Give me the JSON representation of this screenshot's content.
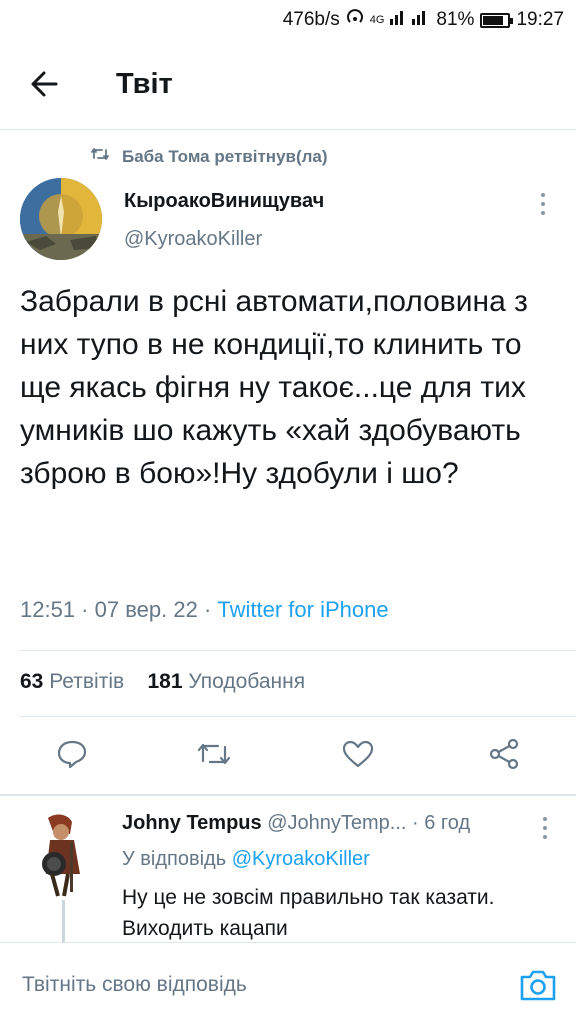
{
  "status_bar": {
    "speed": "476b/s",
    "network": "4G",
    "battery": "81%",
    "time": "19:27"
  },
  "header": {
    "title": "Твіт"
  },
  "retweet": {
    "text": "Баба Тома ретвітнув(ла)"
  },
  "tweet": {
    "author_name": "КыроакоВинищувач",
    "author_handle": "@KyroakoKiller",
    "text": "Забрали в рсні автомати,половина з них тупо в не кондиції,то клинить то ще якась фігня ну такоє...це для тих умників шо кажуть «хай здобувають зброю в бою»!Ну здобули і шо?",
    "time": "12:51",
    "date": "07 вер. 22",
    "source": "Twitter for iPhone",
    "retweets_count": "63",
    "retweets_label": "Ретвітів",
    "likes_count": "181",
    "likes_label": "Уподобання"
  },
  "reply": {
    "name": "Johny Tempus",
    "handle": "@JohnyTemp...",
    "age": "6 год",
    "replying_label": "У відповідь",
    "replying_to": "@KyroakoKiller",
    "text": "Ну це не зовсім правильно так казати. Виходить кацапи"
  },
  "compose": {
    "placeholder": "Твітніть свою відповідь"
  },
  "colors": {
    "accent": "#1da1f2",
    "secondary_text": "#657786",
    "divider": "#e1e8ed"
  }
}
